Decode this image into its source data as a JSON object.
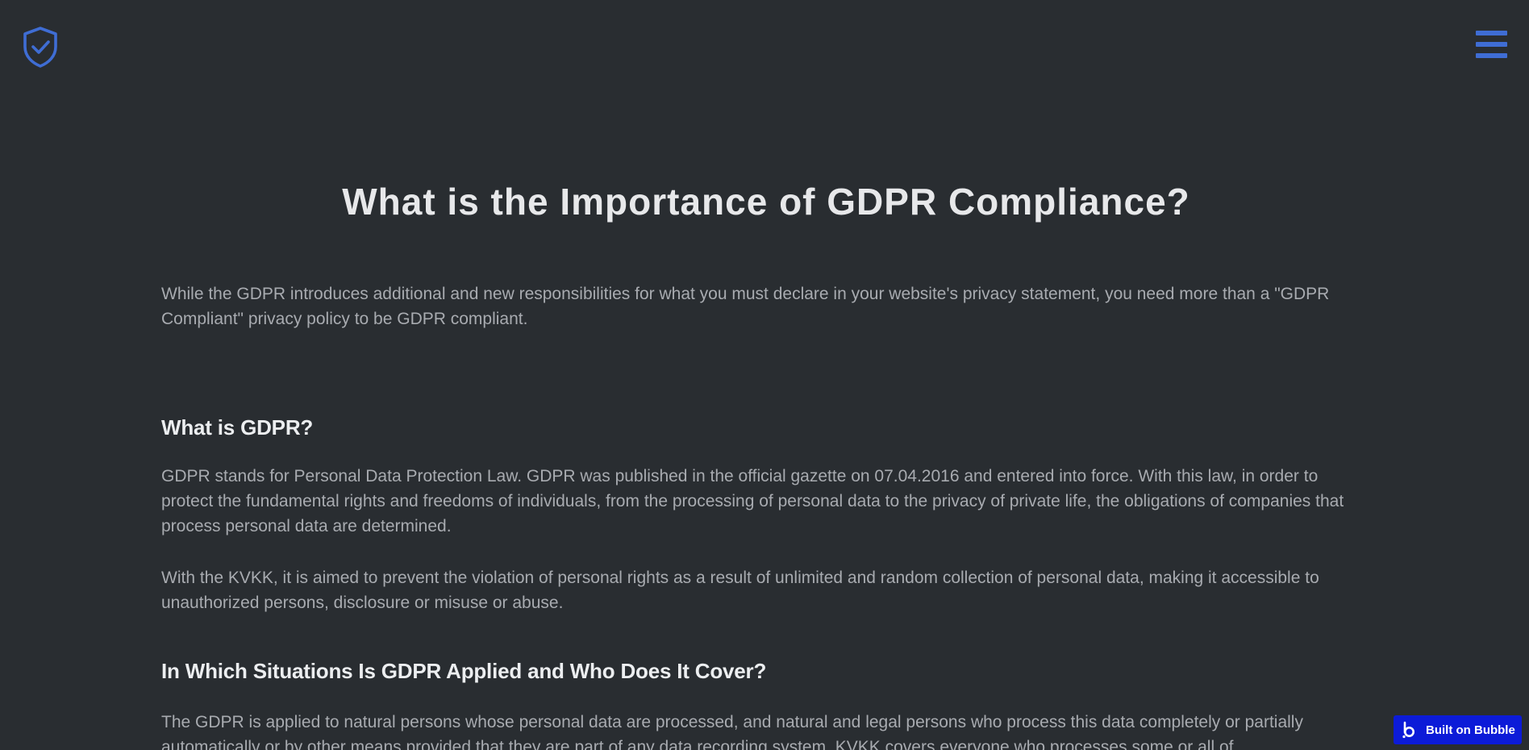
{
  "header": {
    "logo_icon": "shield-check-icon",
    "menu_icon": "hamburger-menu-icon",
    "accent_color": "#3f6dd4"
  },
  "hero": {
    "title": "What is the Importance of GDPR Compliance?"
  },
  "intro": {
    "text": "While the GDPR introduces additional and new responsibilities for what you must declare in your website's privacy statement, you need more than a \"GDPR Compliant\"  privacy policy  to be GDPR compliant."
  },
  "sections": [
    {
      "heading": "What is GDPR?",
      "paragraphs": [
        "GDPR stands for Personal Data Protection Law. GDPR was published in the official gazette on 07.04.2016 and entered into force. With this law, in order to protect the fundamental rights and freedoms of individuals, from the processing of personal data to the privacy of private life, the obligations of companies that process personal data are determined.",
        "With the KVKK, it is aimed to prevent the violation of personal rights as a result of unlimited and random collection of personal data, making it accessible to unauthorized persons, disclosure or misuse or abuse."
      ]
    },
    {
      "heading": "In Which Situations Is GDPR Applied and Who Does It Cover?",
      "paragraphs": [
        "The GDPR is applied to natural persons whose personal data are processed, and natural and legal persons who process this data completely or partially automatically or by other means provided that they are part of any data recording system. KVKK covers everyone who processes some or all of"
      ]
    }
  ],
  "badge": {
    "label": "Built on Bubble",
    "icon": "bubble-logo-icon",
    "color": "#0c1bd8"
  }
}
